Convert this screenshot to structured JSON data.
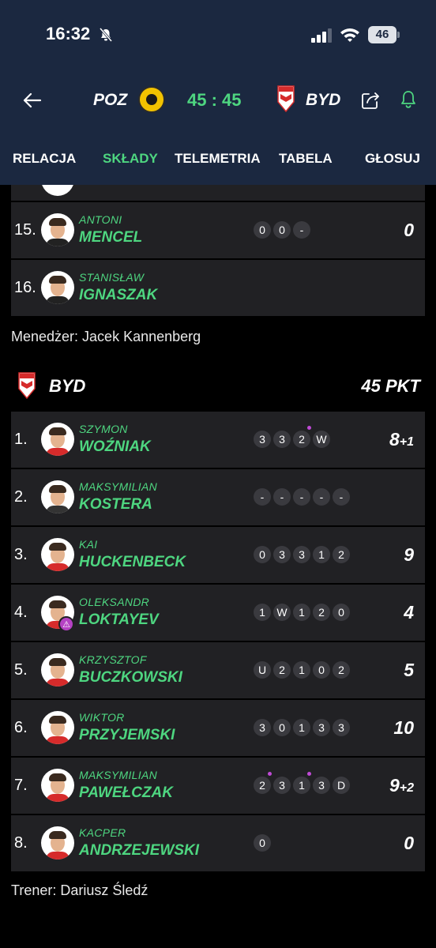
{
  "status_bar": {
    "time": "16:32",
    "battery": "46"
  },
  "match": {
    "home": "POZ",
    "away": "BYD",
    "score": "45 : 45"
  },
  "tabs": [
    {
      "label": "RELACJA",
      "active": false
    },
    {
      "label": "SKŁADY",
      "active": true
    },
    {
      "label": "TELEMETRIA",
      "active": false
    },
    {
      "label": "TABELA",
      "active": false
    },
    {
      "label": "GŁOSUJ",
      "active": false
    }
  ],
  "home_riders": [
    {
      "num": "15.",
      "first": "ANTONI",
      "last": "MENCEL",
      "heats": [
        {
          "v": "0"
        },
        {
          "v": "0"
        },
        {
          "v": "-"
        }
      ],
      "points": "0",
      "bonus": ""
    },
    {
      "num": "16.",
      "first": "STANISŁAW",
      "last": "IGNASZAK",
      "heats": [],
      "points": "",
      "bonus": ""
    }
  ],
  "manager": "Menedżer: Jacek Kannenberg",
  "away_team": {
    "name": "BYD",
    "points": "45 PKT"
  },
  "away_riders": [
    {
      "num": "1.",
      "first": "SZYMON",
      "last": "WOŹNIAK",
      "heats": [
        {
          "v": "3"
        },
        {
          "v": "3"
        },
        {
          "v": "2",
          "dot": true
        },
        {
          "v": "W"
        }
      ],
      "points": "8",
      "bonus": "+1",
      "shirt": "#d62b2b"
    },
    {
      "num": "2.",
      "first": "MAKSYMILIAN",
      "last": "KOSTERA",
      "heats": [
        {
          "v": "-"
        },
        {
          "v": "-"
        },
        {
          "v": "-"
        },
        {
          "v": "-"
        },
        {
          "v": "-"
        }
      ],
      "points": "",
      "bonus": "",
      "shirt": "#333333"
    },
    {
      "num": "3.",
      "first": "KAI",
      "last": "HUCKENBECK",
      "heats": [
        {
          "v": "0"
        },
        {
          "v": "3"
        },
        {
          "v": "3"
        },
        {
          "v": "1"
        },
        {
          "v": "2"
        }
      ],
      "points": "9",
      "bonus": "",
      "shirt": "#d62b2b"
    },
    {
      "num": "4.",
      "first": "OLEKSANDR",
      "last": "LOKTAYEV",
      "heats": [
        {
          "v": "1"
        },
        {
          "v": "W"
        },
        {
          "v": "1"
        },
        {
          "v": "2"
        },
        {
          "v": "0"
        }
      ],
      "points": "4",
      "bonus": "",
      "shirt": "#d62b2b",
      "warning": true
    },
    {
      "num": "5.",
      "first": "KRZYSZTOF",
      "last": "BUCZKOWSKI",
      "heats": [
        {
          "v": "U"
        },
        {
          "v": "2"
        },
        {
          "v": "1"
        },
        {
          "v": "0"
        },
        {
          "v": "2"
        }
      ],
      "points": "5",
      "bonus": "",
      "shirt": "#d62b2b"
    },
    {
      "num": "6.",
      "first": "WIKTOR",
      "last": "PRZYJEMSKI",
      "heats": [
        {
          "v": "3"
        },
        {
          "v": "0"
        },
        {
          "v": "1"
        },
        {
          "v": "3"
        },
        {
          "v": "3"
        }
      ],
      "points": "10",
      "bonus": "",
      "shirt": "#d62b2b"
    },
    {
      "num": "7.",
      "first": "MAKSYMILIAN",
      "last": "PAWEŁCZAK",
      "heats": [
        {
          "v": "2",
          "dot": true
        },
        {
          "v": "3"
        },
        {
          "v": "1",
          "dot": true
        },
        {
          "v": "3"
        },
        {
          "v": "D"
        }
      ],
      "points": "9",
      "bonus": "+2",
      "shirt": "#d62b2b"
    },
    {
      "num": "8.",
      "first": "KACPER",
      "last": "ANDRZEJEWSKI",
      "heats": [
        {
          "v": "0"
        }
      ],
      "points": "0",
      "bonus": "",
      "shirt": "#d62b2b"
    }
  ],
  "coach": "Trener: Dariusz Śledź",
  "colors": {
    "accent": "#4ed680",
    "header_bg": "#1b2840",
    "card_bg": "#212124",
    "heat_bg": "#3a3a3f",
    "bonus_dot": "#c04ad6"
  }
}
